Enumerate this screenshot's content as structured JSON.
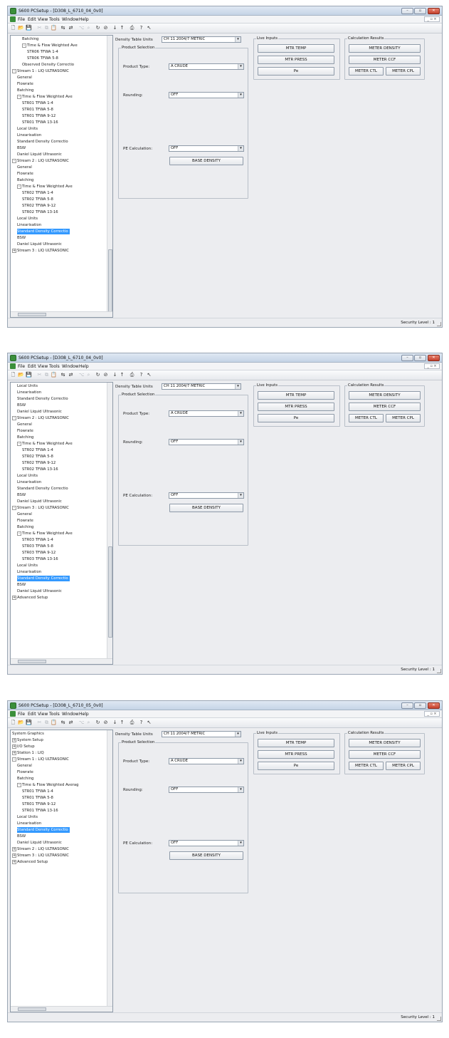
{
  "app": {
    "menu": [
      "File",
      "Edit",
      "View",
      "Tools",
      "Window",
      "Help"
    ],
    "child_buttons": "_ ▫ ×",
    "labels": {
      "density_table_units": "Density Table Units",
      "product_selection": "Product Selection",
      "product_type": "Product Type:",
      "rounding": "Rounding:",
      "pe_calculation": "PE Calculation:",
      "live_inputs": "Live Inputs",
      "calculation_results": "Calculation Results"
    },
    "fields": {
      "density_table_units": "CH 11 2004/7 METRIC",
      "product_type": "A CRUDE",
      "rounding": "OFF",
      "pe_calculation": "OFF"
    },
    "buttons": {
      "base_density": "BASE DENSITY",
      "mtr_temp": "MTR TEMP",
      "mtr_press": "MTR PRESS",
      "pe": "Pe",
      "meter_density": "METER DENSITY",
      "meter_ccf": "METER CCF",
      "meter_ctl": "METER CTL",
      "meter_cpl": "METER CPL"
    },
    "status": "Security Level : 1",
    "colors": {
      "selection": "#3399ff",
      "close_button": "#c4402c",
      "window_bg": "#ecedf0"
    }
  },
  "screenshots": [
    {
      "title": "S600 PCSetup - [D308_L_6710_04_0v0]",
      "tree": [
        {
          "text": "Batching",
          "level": 2,
          "selected": false
        },
        {
          "text": "Time & Flow Weighted Ave",
          "level": 2,
          "expander": "-",
          "selected": false
        },
        {
          "text": "STR06 TFWA 1-4",
          "level": 3,
          "selected": false
        },
        {
          "text": "STR06 TFWA 5-8",
          "level": 3,
          "selected": false
        },
        {
          "text": "Observed Density Correctio",
          "level": 2,
          "selected": false
        },
        {
          "text": "Stream 1 : LIQ ULTRASONIC",
          "level": 0,
          "expander": "-",
          "selected": false
        },
        {
          "text": "General",
          "level": 1,
          "selected": false
        },
        {
          "text": "Flowrate",
          "level": 1,
          "selected": false
        },
        {
          "text": "Batching",
          "level": 1,
          "selected": false
        },
        {
          "text": "Time & Flow Weighted Ave",
          "level": 1,
          "expander": "-",
          "selected": false
        },
        {
          "text": "STR01 TFWA 1-4",
          "level": 2,
          "selected": false
        },
        {
          "text": "STR01 TFWA 5-8",
          "level": 2,
          "selected": false
        },
        {
          "text": "STR01 TFWA 9-12",
          "level": 2,
          "selected": false
        },
        {
          "text": "STR01 TFWA 13-16",
          "level": 2,
          "selected": false
        },
        {
          "text": "Local Units",
          "level": 1,
          "selected": false
        },
        {
          "text": "Linearisation",
          "level": 1,
          "selected": false
        },
        {
          "text": "Standard Density Correctio",
          "level": 1,
          "selected": false
        },
        {
          "text": "BSW",
          "level": 1,
          "selected": false
        },
        {
          "text": "Daniel Liquid Ultrasonic",
          "level": 1,
          "selected": false
        },
        {
          "text": "Stream 2 : LIQ ULTRASONIC",
          "level": 0,
          "expander": "-",
          "selected": false
        },
        {
          "text": "General",
          "level": 1,
          "selected": false
        },
        {
          "text": "Flowrate",
          "level": 1,
          "selected": false
        },
        {
          "text": "Batching",
          "level": 1,
          "selected": false
        },
        {
          "text": "Time & Flow Weighted Ave",
          "level": 1,
          "expander": "-",
          "selected": false
        },
        {
          "text": "STR02 TFWA 1-4",
          "level": 2,
          "selected": false
        },
        {
          "text": "STR02 TFWA 5-8",
          "level": 2,
          "selected": false
        },
        {
          "text": "STR02 TFWA 9-12",
          "level": 2,
          "selected": false
        },
        {
          "text": "STR02 TFWA 13-16",
          "level": 2,
          "selected": false
        },
        {
          "text": "Local Units",
          "level": 1,
          "selected": false
        },
        {
          "text": "Linearisation",
          "level": 1,
          "selected": false
        },
        {
          "text": "Standard Density Correctio",
          "level": 1,
          "selected": true
        },
        {
          "text": "BSW",
          "level": 1,
          "selected": false
        },
        {
          "text": "Daniel Liquid Ultrasonic",
          "level": 1,
          "selected": false
        },
        {
          "text": "Stream 3 : LIQ ULTRASONIC",
          "level": 0,
          "expander": "+",
          "selected": false
        }
      ]
    },
    {
      "title": "S600 PCSetup - [D308_L_6710_04_0v0]",
      "tree": [
        {
          "text": "Local Units",
          "level": 1,
          "selected": false
        },
        {
          "text": "Linearisation",
          "level": 1,
          "selected": false
        },
        {
          "text": "Standard Density Correctio",
          "level": 1,
          "selected": false
        },
        {
          "text": "BSW",
          "level": 1,
          "selected": false
        },
        {
          "text": "Daniel Liquid Ultrasonic",
          "level": 1,
          "selected": false
        },
        {
          "text": "Stream 2 : LIQ ULTRASONIC",
          "level": 0,
          "expander": "-",
          "selected": false
        },
        {
          "text": "General",
          "level": 1,
          "selected": false
        },
        {
          "text": "Flowrate",
          "level": 1,
          "selected": false
        },
        {
          "text": "Batching",
          "level": 1,
          "selected": false
        },
        {
          "text": "Time & Flow Weighted Ave",
          "level": 1,
          "expander": "-",
          "selected": false
        },
        {
          "text": "STR02 TFWA 1-4",
          "level": 2,
          "selected": false
        },
        {
          "text": "STR02 TFWA 5-8",
          "level": 2,
          "selected": false
        },
        {
          "text": "STR02 TFWA 9-12",
          "level": 2,
          "selected": false
        },
        {
          "text": "STR02 TFWA 13-16",
          "level": 2,
          "selected": false
        },
        {
          "text": "Local Units",
          "level": 1,
          "selected": false
        },
        {
          "text": "Linearisation",
          "level": 1,
          "selected": false
        },
        {
          "text": "Standard Density Correctio",
          "level": 1,
          "selected": false
        },
        {
          "text": "BSW",
          "level": 1,
          "selected": false
        },
        {
          "text": "Daniel Liquid Ultrasonic",
          "level": 1,
          "selected": false
        },
        {
          "text": "Stream 3 : LIQ ULTRASONIC",
          "level": 0,
          "expander": "-",
          "selected": false
        },
        {
          "text": "General",
          "level": 1,
          "selected": false
        },
        {
          "text": "Flowrate",
          "level": 1,
          "selected": false
        },
        {
          "text": "Batching",
          "level": 1,
          "selected": false
        },
        {
          "text": "Time & Flow Weighted Ave",
          "level": 1,
          "expander": "-",
          "selected": false
        },
        {
          "text": "STR03 TFWA 1-4",
          "level": 2,
          "selected": false
        },
        {
          "text": "STR03 TFWA 5-8",
          "level": 2,
          "selected": false
        },
        {
          "text": "STR03 TFWA 9-12",
          "level": 2,
          "selected": false
        },
        {
          "text": "STR03 TFWA 13-16",
          "level": 2,
          "selected": false
        },
        {
          "text": "Local Units",
          "level": 1,
          "selected": false
        },
        {
          "text": "Linearisation",
          "level": 1,
          "selected": false
        },
        {
          "text": "Standard Density Correctio",
          "level": 1,
          "selected": true
        },
        {
          "text": "BSW",
          "level": 1,
          "selected": false
        },
        {
          "text": "Daniel Liquid Ultrasonic",
          "level": 1,
          "selected": false
        },
        {
          "text": "Advanced Setup",
          "level": 0,
          "expander": "+",
          "selected": false
        }
      ]
    },
    {
      "title": "S600 PCSetup - [D308_L_6710_05_0v0]",
      "tree": [
        {
          "text": "System Graphics",
          "level": 0,
          "selected": false
        },
        {
          "text": "System Setup",
          "level": 0,
          "expander": "+",
          "selected": false
        },
        {
          "text": "I/O Setup",
          "level": 0,
          "expander": "+",
          "selected": false
        },
        {
          "text": "Station 1 : LIQ",
          "level": 0,
          "expander": "+",
          "selected": false
        },
        {
          "text": "Stream 1 : LIQ ULTRASONIC",
          "level": 0,
          "expander": "-",
          "selected": false
        },
        {
          "text": "General",
          "level": 1,
          "selected": false
        },
        {
          "text": "Flowrate",
          "level": 1,
          "selected": false
        },
        {
          "text": "Batching",
          "level": 1,
          "selected": false
        },
        {
          "text": "Time & Flow Weighted Averag",
          "level": 1,
          "expander": "-",
          "selected": false
        },
        {
          "text": "STR01 TFWA 1-4",
          "level": 2,
          "selected": false
        },
        {
          "text": "STR01 TFWA 5-8",
          "level": 2,
          "selected": false
        },
        {
          "text": "STR01 TFWA 9-12",
          "level": 2,
          "selected": false
        },
        {
          "text": "STR01 TFWA 13-16",
          "level": 2,
          "selected": false
        },
        {
          "text": "Local Units",
          "level": 1,
          "selected": false
        },
        {
          "text": "Linearisation",
          "level": 1,
          "selected": false
        },
        {
          "text": "Standard Density Correctio",
          "level": 1,
          "selected": true
        },
        {
          "text": "BSW",
          "level": 1,
          "selected": false
        },
        {
          "text": "Daniel Liquid Ultrasonic",
          "level": 1,
          "selected": false
        },
        {
          "text": "Stream 2 : LIQ ULTRASONIC",
          "level": 0,
          "expander": "+",
          "selected": false
        },
        {
          "text": "Stream 3 : LIQ ULTRASONIC",
          "level": 0,
          "expander": "+",
          "selected": false
        },
        {
          "text": "Advanced Setup",
          "level": 0,
          "expander": "+",
          "selected": false
        }
      ]
    }
  ]
}
